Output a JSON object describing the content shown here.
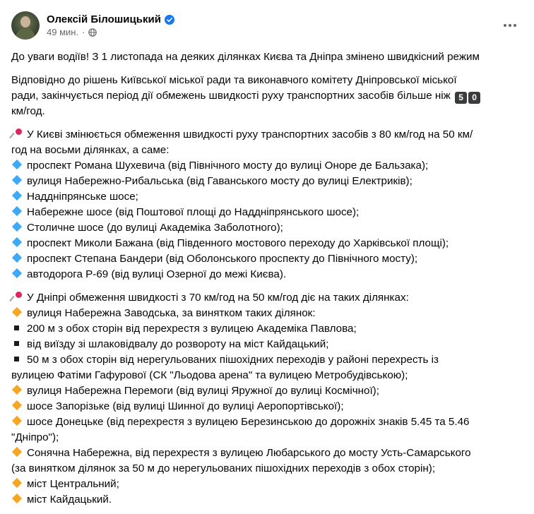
{
  "post": {
    "author": "Олексій Білошицький",
    "time": "49 мин.",
    "separator": "·"
  },
  "icons": {
    "verified": "verified-badge-icon",
    "audience": "globe-icon",
    "more": "more-options-icon",
    "pin": "round-pushpin-icon",
    "blue_diamond": "small-blue-diamond-icon",
    "orange_diamond": "small-orange-diamond-icon",
    "black_square": "black-small-square-icon"
  },
  "colors": {
    "text": "#050505",
    "secondary": "#65676b",
    "verified": "#1877f2",
    "blue_diamond": "#3fa9f5",
    "orange_diamond": "#f5a623",
    "pin": "#e0245e"
  },
  "content": {
    "headline": "До уваги водіїв! З 1 листопада на деяких ділянках Києва та Дніпра змінено швидкісний режим",
    "intro": [
      "Відповідно до рішень Київської міської ради та виконавчого комітету Дніпровської міської",
      "ради, закінчується період дії обмежень швидкості руху транспортних засобів більше ніж",
      "км/год."
    ],
    "intro_keycaps": [
      "5",
      "0"
    ],
    "kyiv_intro": [
      "У Києві змінюється обмеження швидкості руху транспортних засобів з 80 км/год на 50 км/",
      "год на восьми ділянках, а саме:"
    ],
    "kyiv_items": [
      "проспект Романа Шухевича (від Північного мосту до вулиці Оноре де Бальзака);",
      "вулиця Набережно-Рибальська (від Гаванського мосту до вулиці Електриків);",
      "Наддніпрянське шосе;",
      "Набережне шосе (від Поштової площі до Наддніпрянського шосе);",
      "Столичне шосе (до вулиці Академіка Заболотного);",
      "проспект Миколи Бажана (від Південного мостового переходу до Харківської площі);",
      "проспект Степана Бандери (від Оболонського проспекту до Північного мосту);",
      "автодорога Р-69 (від вулиці Озерної до межі Києва)."
    ],
    "dnipro_intro": "У Дніпрі обмеження швидкості з 70 км/год на 50 км/год діє на таких ділянках:",
    "dnipro_item1": "вулиця Набережна Заводська, за винятком таких ділянок:",
    "dnipro_sub": [
      "200 м з обох сторін від перехрестя з вулицею Академіка Павлова;",
      "від виїзду зі шлаковідвалу до розвороту на міст Кайдацький;"
    ],
    "dnipro_sub3": [
      "50 м з обох сторін від нерегульованих пішохідних переходів у районі перехресть із",
      "вулицею Фатіми Гафурової (СК \"Льодова арена\" та вулицею Метробудівською);"
    ],
    "dnipro_item2": "вулиця Набережна Перемоги (від вулиці Яружної до вулиці Космічної);",
    "dnipro_item3": "шосе Запорізьке (від вулиці Шинної до вулиці Аеропортівської);",
    "dnipro_item4": [
      "шосе Донецьке (від перехрестя з вулицею Березинською до дорожніх знаків 5.45 та 5.46",
      "\"Дніпро\");"
    ],
    "dnipro_item5": [
      "Сонячна Набережна, від перехрестя з вулицею Любарського до мосту Усть-Самарського",
      "(за винятком ділянок за 50 м до нерегульованих пішохідних переходів з обох сторін);"
    ],
    "dnipro_item6": "міст Центральний;",
    "dnipro_item7": "міст Кайдацький."
  }
}
